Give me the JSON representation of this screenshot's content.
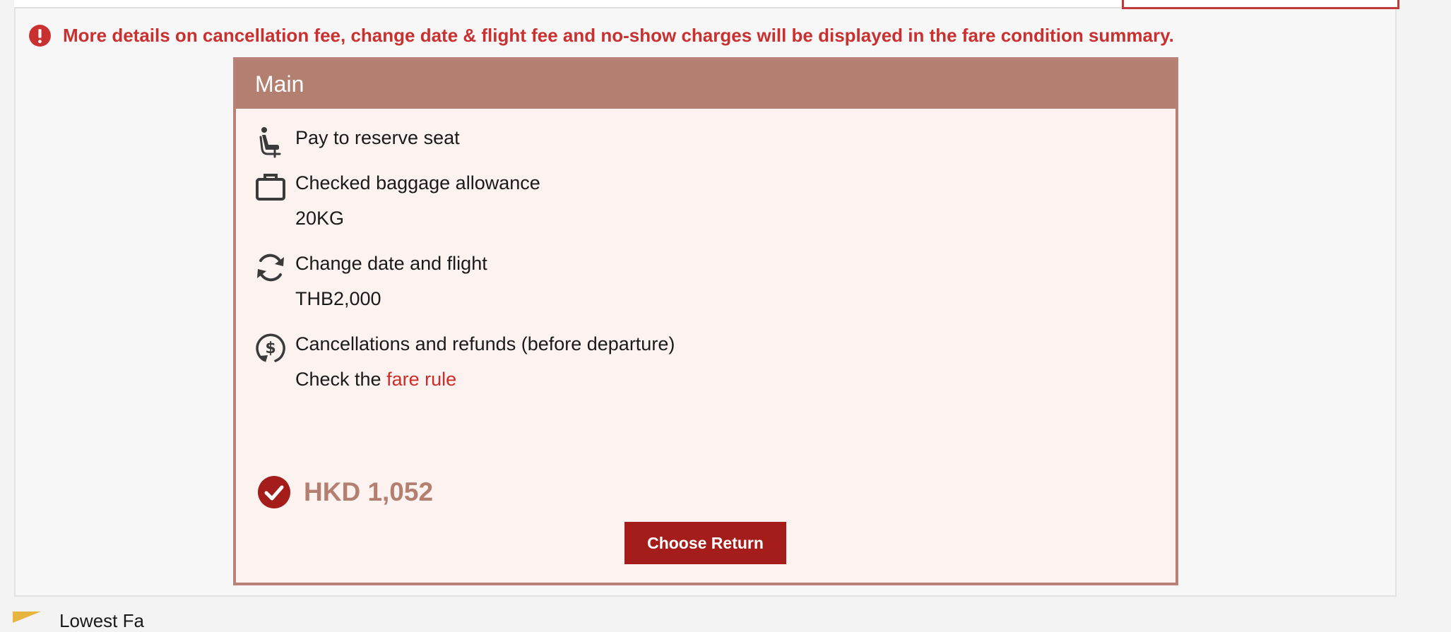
{
  "notice": {
    "text": "More details on cancellation fee, change date & flight fee and no-show charges will be displayed in the fare condition summary.",
    "color": "#c8312f"
  },
  "fare": {
    "name": "Main",
    "header_color": "#b37f70",
    "features": [
      {
        "icon": "seat-icon",
        "title": "Pay to reserve seat",
        "value": ""
      },
      {
        "icon": "baggage-icon",
        "title": "Checked baggage allowance",
        "value": "20KG"
      },
      {
        "icon": "change-flight-icon",
        "title": "Change date and flight",
        "value": "THB2,000"
      },
      {
        "icon": "refund-icon",
        "title": "Cancellations and refunds (before departure)",
        "value_prefix": "Check the ",
        "link_text": "fare rule"
      }
    ],
    "price": "HKD 1,052",
    "selected": true,
    "button_label": "Choose Return",
    "button_color": "#a41d1a"
  },
  "footer": {
    "text": "Lowest Fa"
  }
}
